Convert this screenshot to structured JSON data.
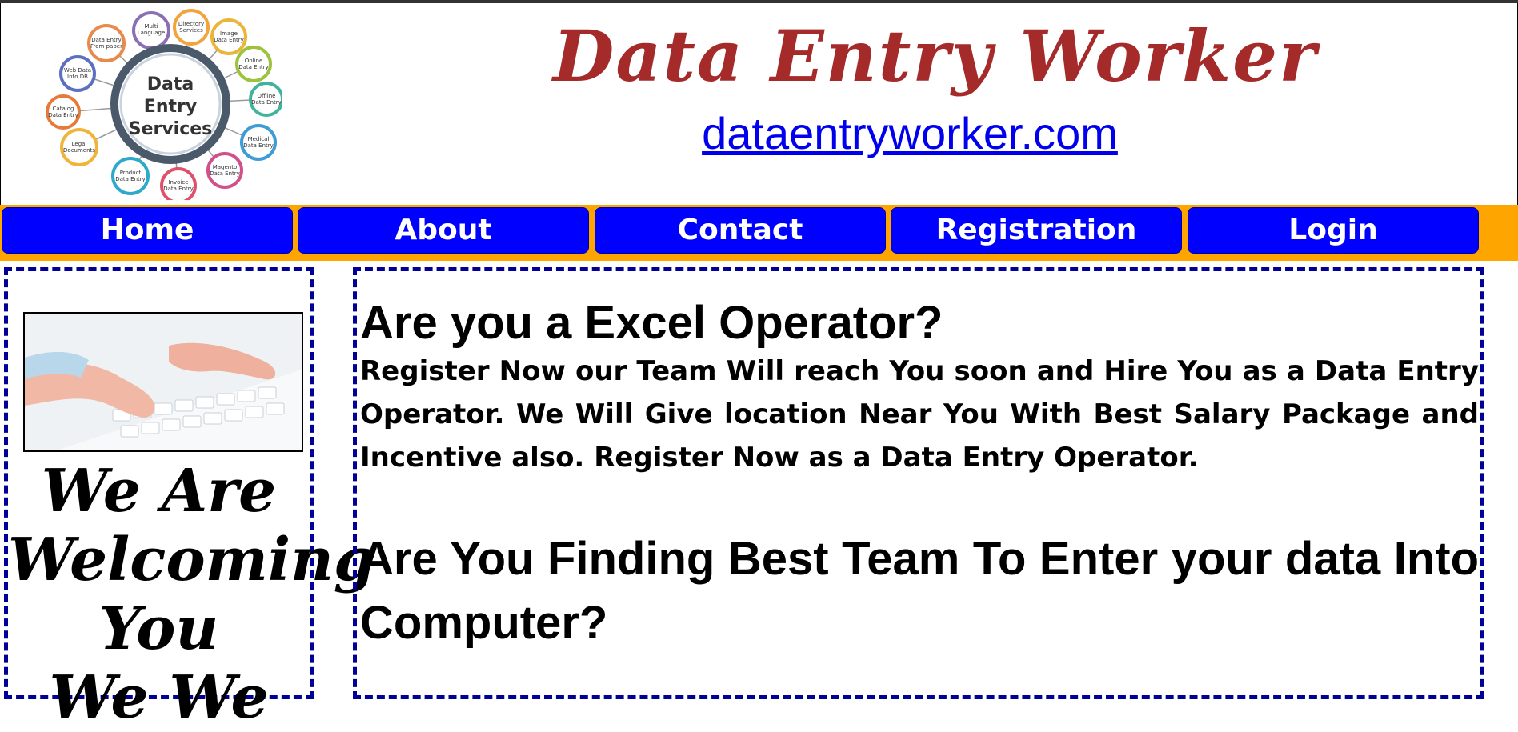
{
  "header": {
    "logo": {
      "center_lines": [
        "Data",
        "Entry",
        "Services"
      ],
      "bubbles": [
        "Multi Language data entry services",
        "Directory Services",
        "Image Data Entry Services",
        "Online Data Entry Services",
        "Offline Data Entry Services",
        "Medical Data Entry Services",
        "Magento Data Entry Services",
        "Invoice Data Entry Services",
        "Product Data Entry Services",
        "Legal Documents Data Entry Services",
        "Catalog Data Entry Services",
        "Web Data Into Database",
        "Data Entry From paper documents"
      ]
    },
    "title": "Data Entry Worker",
    "link": "dataentryworker.com"
  },
  "nav": {
    "items": [
      "Home",
      "About",
      "Contact",
      "Registration",
      "Login"
    ]
  },
  "sidebar": {
    "welcome_lines": [
      "We Are",
      "Welcoming",
      "You",
      "We We"
    ]
  },
  "main": {
    "heading1": "Are you a Excel Operator?",
    "paragraph1": "Register Now our Team Will reach You soon and Hire You as a Data Entry Operator. We Will Give location Near You With Best Salary Package and Incentive also. Register Now as a Data Entry Operator.",
    "heading2": "Are You Finding Best Team To Enter your data Into Computer?"
  },
  "colors": {
    "title": "#a52a2a",
    "link": "#0000ee",
    "nav_bar": "#ffa500",
    "nav_button": "#0000ff",
    "dashed_border": "#000099"
  }
}
